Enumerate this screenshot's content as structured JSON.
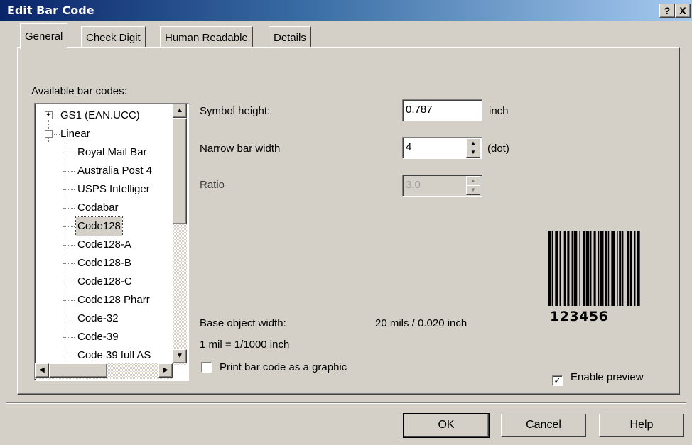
{
  "window": {
    "title": "Edit Bar Code",
    "help_button": "?",
    "close_button": "X"
  },
  "tabs": [
    {
      "label": "General",
      "active": true
    },
    {
      "label": "Check Digit",
      "active": false
    },
    {
      "label": "Human Readable",
      "active": false
    },
    {
      "label": "Details",
      "active": false
    }
  ],
  "available": {
    "label": "Available bar codes:",
    "tree": [
      {
        "label": "GS1 (EAN.UCC)",
        "level": 0,
        "expander": "+"
      },
      {
        "label": "Linear",
        "level": 0,
        "expander": "-"
      },
      {
        "label": "Royal Mail Bar",
        "level": 1
      },
      {
        "label": "Australia Post 4",
        "level": 1
      },
      {
        "label": "USPS Intelliger",
        "level": 1
      },
      {
        "label": "Codabar",
        "level": 1
      },
      {
        "label": "Code128",
        "level": 1,
        "selected": true
      },
      {
        "label": "Code128-A",
        "level": 1
      },
      {
        "label": "Code128-B",
        "level": 1
      },
      {
        "label": "Code128-C",
        "level": 1
      },
      {
        "label": "Code128 Pharr",
        "level": 1
      },
      {
        "label": "Code-32",
        "level": 1
      },
      {
        "label": "Code-39",
        "level": 1
      },
      {
        "label": "Code 39 full AS",
        "level": 1
      }
    ]
  },
  "fields": {
    "symbol_height_label": "Symbol height:",
    "symbol_height_value": "0.787",
    "symbol_height_unit": "inch",
    "narrow_bar_label": "Narrow bar width",
    "narrow_bar_value": "4",
    "narrow_bar_unit": "(dot)",
    "ratio_label": "Ratio",
    "ratio_value": "3.0"
  },
  "info": {
    "base_width_label": "Base object width:",
    "base_width_value": "20 mils / 0.020 inch",
    "mil_note": "1 mil = 1/1000 inch"
  },
  "options": {
    "print_graphic_label": "Print bar code as a graphic",
    "print_graphic_checked": false,
    "enable_preview_label": "Enable preview",
    "enable_preview_checked": true
  },
  "preview": {
    "human_readable": "123456"
  },
  "buttons": {
    "ok": "OK",
    "cancel": "Cancel",
    "help": "Help"
  }
}
